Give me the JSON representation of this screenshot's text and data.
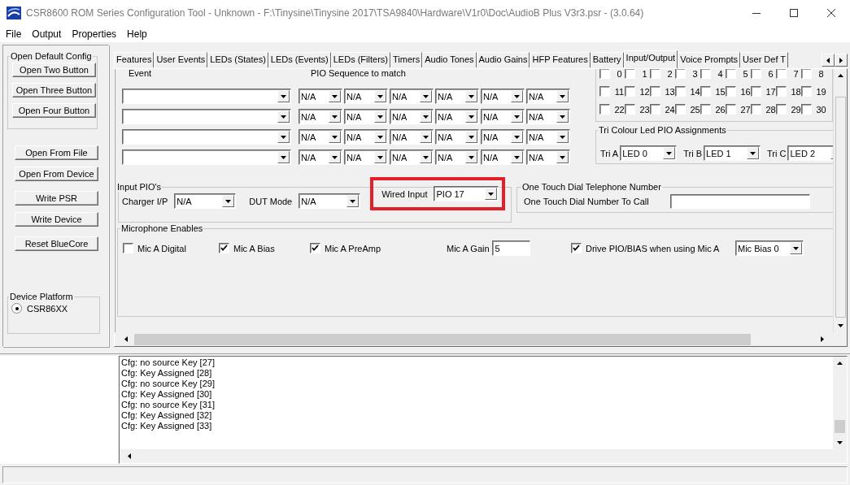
{
  "window": {
    "title": "CSR8600 ROM Series Configuration Tool - Unknown - F:\\Tinysine\\Tinysine 2017\\TSA9840\\Hardware\\V1r0\\Doc\\AudioB Plus V3r3.psr - (3.0.64)"
  },
  "menu": [
    "File",
    "Output",
    "Properties",
    "Help"
  ],
  "open_default_config": {
    "title": "Open Default Config",
    "buttons": [
      "Open Two Button",
      "Open Three Button",
      "Open Four Button"
    ]
  },
  "side_button_groups": [
    [
      "Open From File",
      "Open From Device"
    ],
    [
      "Write PSR",
      "Write Device"
    ],
    [
      "Reset BlueCore"
    ]
  ],
  "device_platform": {
    "title": "Device Platform",
    "options": [
      {
        "label": "CSR86XX",
        "selected": true
      }
    ]
  },
  "tabs": [
    {
      "label": "Features",
      "selected": false
    },
    {
      "label": "User Events",
      "selected": false
    },
    {
      "label": "LEDs (States)",
      "selected": false
    },
    {
      "label": "LEDs (Events)",
      "selected": false
    },
    {
      "label": "LEDs (Filters)",
      "selected": false
    },
    {
      "label": "Timers",
      "selected": false
    },
    {
      "label": "Audio Tones",
      "selected": false
    },
    {
      "label": "Audio Gains",
      "selected": false
    },
    {
      "label": "HFP Features",
      "selected": false
    },
    {
      "label": "Battery",
      "selected": false
    },
    {
      "label": "Input/Output",
      "selected": true
    },
    {
      "label": "Voice Prompts",
      "selected": false
    },
    {
      "label": "User Def T",
      "selected": false
    }
  ],
  "events": {
    "event_header": "Event",
    "sequence_header": "PIO Sequence to match",
    "rows": [
      {
        "sequence": [
          "N/A",
          "N/A",
          "N/A",
          "N/A",
          "N/A",
          "N/A"
        ]
      },
      {
        "sequence": [
          "N/A",
          "N/A",
          "N/A",
          "N/A",
          "N/A",
          "N/A"
        ]
      },
      {
        "sequence": [
          "N/A",
          "N/A",
          "N/A",
          "N/A",
          "N/A",
          "N/A"
        ]
      },
      {
        "sequence": [
          "N/A",
          "N/A",
          "N/A",
          "N/A",
          "N/A",
          "N/A"
        ]
      }
    ]
  },
  "pio_checkboxes": [
    [
      {
        "label": "0",
        "checked": false
      },
      {
        "label": "1",
        "checked": false
      },
      {
        "label": "2",
        "checked": false
      },
      {
        "label": "3",
        "checked": false
      },
      {
        "label": "4",
        "checked": false
      },
      {
        "label": "5",
        "checked": false
      },
      {
        "label": "6",
        "checked": false
      },
      {
        "label": "7",
        "checked": false
      },
      {
        "label": "8",
        "checked": false
      }
    ],
    [
      {
        "label": "11",
        "checked": false
      },
      {
        "label": "12",
        "checked": false
      },
      {
        "label": "13",
        "checked": false
      },
      {
        "label": "14",
        "checked": false
      },
      {
        "label": "15",
        "checked": false
      },
      {
        "label": "16",
        "checked": false
      },
      {
        "label": "17",
        "checked": false
      },
      {
        "label": "18",
        "checked": false
      },
      {
        "label": "19",
        "checked": false
      }
    ],
    [
      {
        "label": "22",
        "checked": false
      },
      {
        "label": "23",
        "checked": false
      },
      {
        "label": "24",
        "checked": false
      },
      {
        "label": "25",
        "checked": false
      },
      {
        "label": "26",
        "checked": false
      },
      {
        "label": "27",
        "checked": false
      },
      {
        "label": "28",
        "checked": false
      },
      {
        "label": "29",
        "checked": false
      },
      {
        "label": "30",
        "checked": false
      }
    ]
  ],
  "tri_colour": {
    "title": "Tri Colour Led PIO Assignments",
    "fields": [
      {
        "label": "Tri A",
        "value": "LED 0"
      },
      {
        "label": "Tri B",
        "value": "LED 1"
      },
      {
        "label": "Tri C",
        "value": "LED 2"
      }
    ]
  },
  "input_pios": {
    "title": "Input PIO's",
    "fields": [
      {
        "label": "Charger I/P",
        "value": "N/A",
        "highlighted": false
      },
      {
        "label": "DUT Mode",
        "value": "N/A",
        "highlighted": false
      },
      {
        "label": "Wired Input",
        "value": "PIO 17",
        "highlighted": true
      }
    ]
  },
  "one_touch": {
    "title": "One Touch Dial Telephone Number",
    "label": "One Touch Dial Number To Call"
  },
  "microphone": {
    "title": "Microphone Enables",
    "items": [
      {
        "kind": "checkbox",
        "label": "Mic A Digital",
        "checked": false
      },
      {
        "kind": "checkbox",
        "label": "Mic A Bias",
        "checked": true
      },
      {
        "kind": "checkbox",
        "label": "Mic A PreAmp",
        "checked": true
      },
      {
        "kind": "field",
        "label": "Mic A Gain",
        "value": "5"
      },
      {
        "kind": "checkbox",
        "label": "Drive PIO/BIAS when using Mic A",
        "checked": true
      },
      {
        "kind": "select",
        "value": "Mic Bias 0"
      }
    ]
  },
  "log": [
    "Cfg: no source Key [27]",
    "Cfg: Key Assigned [28]",
    "Cfg: no source Key [29]",
    "Cfg: Key Assigned [30]",
    "Cfg: no source Key [31]",
    "Cfg: Key Assigned [32]",
    "Cfg: Key Assigned [33]"
  ]
}
